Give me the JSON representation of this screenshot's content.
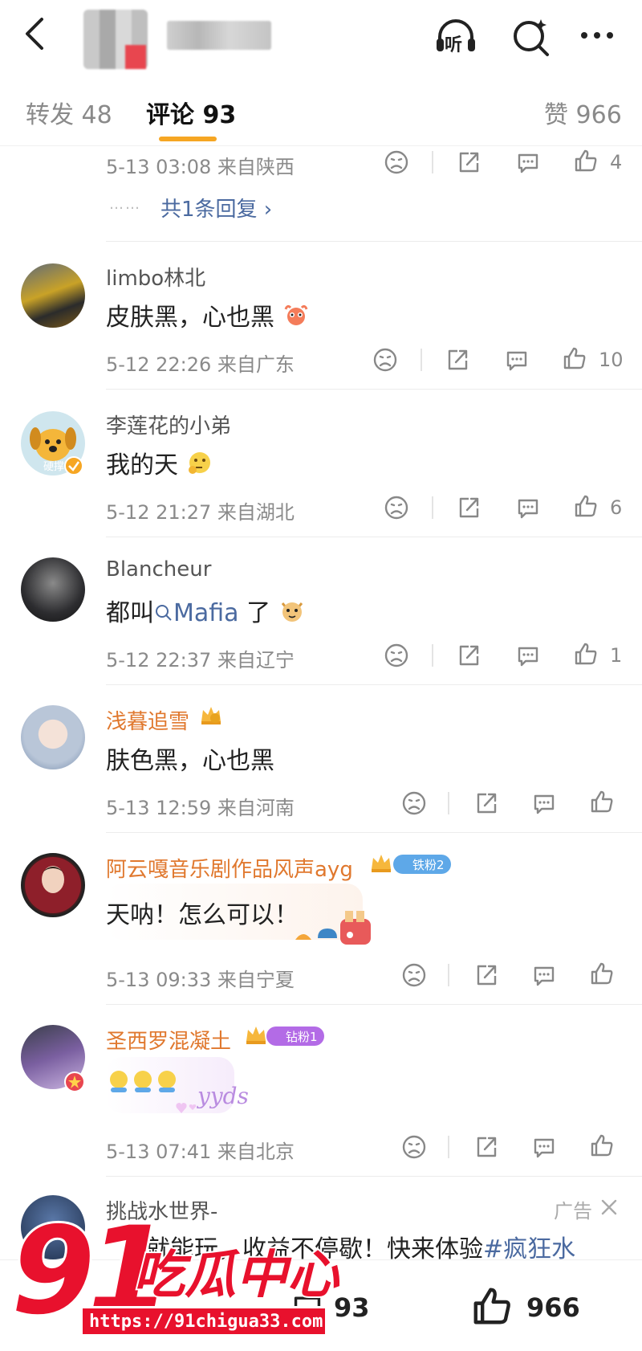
{
  "tabs": {
    "repost": "转发 48",
    "comments": "评论 93",
    "likes": "赞 966"
  },
  "top_icons": {
    "listen_label": "听"
  },
  "partial_comment": {
    "meta": "5-13 03:08  来自陕西",
    "like_count": "4",
    "reply_link": "共1条回复 ›",
    "dots": "……"
  },
  "comments": [
    {
      "username": "limbo林北",
      "text": "皮肤黑，心也黑",
      "meta": "5-12 22:26  来自广东",
      "like_count": "10"
    },
    {
      "username": "李莲花的小弟",
      "text": "我的天",
      "meta": "5-12 21:27  来自湖北",
      "like_count": "6",
      "avatar_label": "硬撑"
    },
    {
      "username": "Blancheur",
      "text_before": "都叫",
      "topic": "Mafia",
      "text_after": " 了",
      "meta": "5-12 22:37  来自辽宁",
      "like_count": "1"
    },
    {
      "username": "浅暮追雪",
      "text": "肤色黑，心也黑",
      "meta": "5-13 12:59  来自河南",
      "like_count": ""
    },
    {
      "username": "阿云嘎音乐剧作品风声ayg",
      "badge": "铁粉2",
      "text": "天呐！怎么可以！",
      "meta": "5-13 09:33  来自宁夏",
      "like_count": ""
    },
    {
      "username": "圣西罗混凝土",
      "badge": "钻粉1",
      "sticker_text": "yyds",
      "meta": "5-13 07:41  来自北京",
      "like_count": ""
    }
  ],
  "ad": {
    "username": "挑战水世界-",
    "text_before": "置就能玩，收益不停歇！快来体验",
    "hashtag": "#疯狂水",
    "label": "广告"
  },
  "bottom_bar": {
    "comment_count": "93",
    "like_count": "966"
  },
  "watermark": {
    "number": "91",
    "name": "吃瓜中心",
    "url": "https://91chigua33.com"
  },
  "colors": {
    "accent_tab": "#f6a623",
    "vip_name": "#e0782e",
    "link": "#4b6aa0",
    "watermark": "#e8112d"
  }
}
